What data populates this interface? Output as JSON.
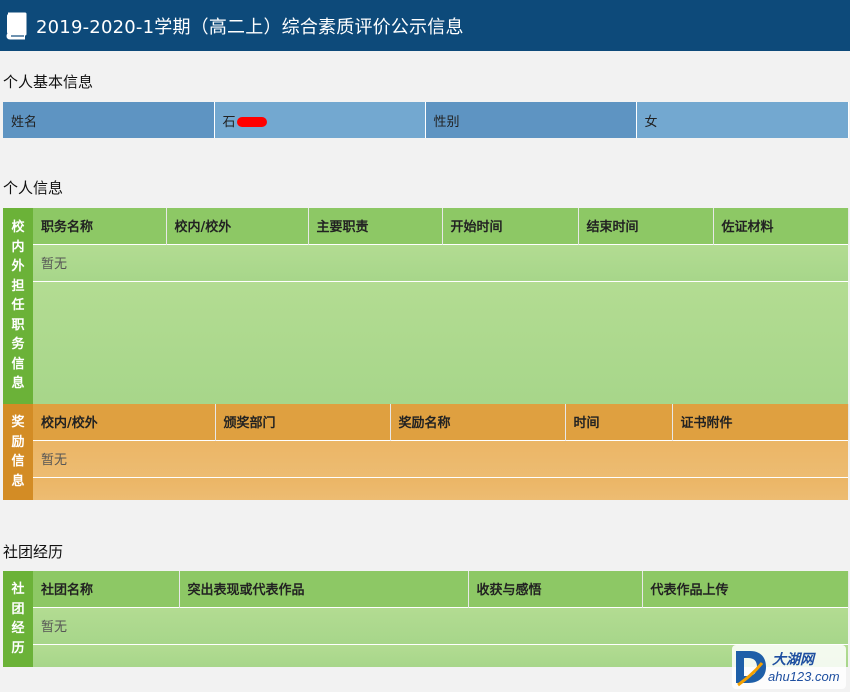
{
  "header": {
    "title": "2019-2020-1学期（高二上）综合素质评价公示信息",
    "icon": "book-icon"
  },
  "basic_info": {
    "section_title": "个人基本信息",
    "name_label": "姓名",
    "name_value": "石",
    "gender_label": "性别",
    "gender_value": "女"
  },
  "personal_info": {
    "section_title": "个人信息",
    "positions": {
      "side_label": [
        "校",
        "内",
        "外",
        "担",
        "任",
        "职",
        "务",
        "信",
        "息"
      ],
      "columns": [
        "职务名称",
        "校内/校外",
        "主要职责",
        "开始时间",
        "结束时间",
        "佐证材料"
      ],
      "empty_text": "暂无"
    },
    "awards": {
      "side_label": [
        "奖",
        "励",
        "信",
        "息"
      ],
      "columns": [
        "校内/校外",
        "颁奖部门",
        "奖励名称",
        "时间",
        "证书附件"
      ],
      "empty_text": "暂无"
    }
  },
  "club": {
    "section_title": "社团经历",
    "side_label": [
      "社",
      "团",
      "经",
      "历"
    ],
    "columns": [
      "社团名称",
      "突出表现或代表作品",
      "收获与感悟",
      "代表作品上传"
    ],
    "empty_text": "暂无"
  },
  "watermark": {
    "brand": "大湖网",
    "url": "ahu123.com"
  },
  "colors": {
    "header_bg": "#0d4a7a",
    "green": "#8dc865",
    "orange": "#dfa040",
    "blue": "#5e94c2",
    "redaction": "#ff0000"
  }
}
